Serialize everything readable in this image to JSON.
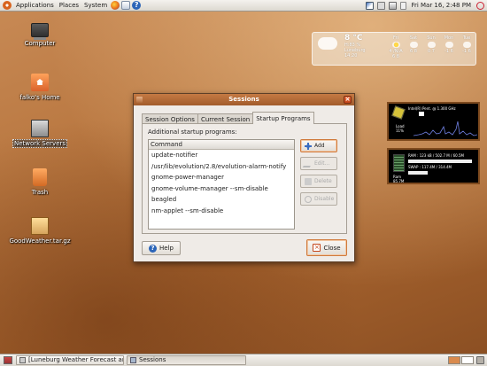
{
  "top_panel": {
    "menus": [
      "Applications",
      "Places",
      "System"
    ],
    "clock": "Fri Mar 16,  2:48 PM"
  },
  "desktop_icons": [
    {
      "label": "Computer",
      "icon": "computer-icon"
    },
    {
      "label": "falko's Home",
      "icon": "home-folder-icon"
    },
    {
      "label": "Network Servers",
      "icon": "network-icon"
    },
    {
      "label": "Trash",
      "icon": "trash-icon"
    },
    {
      "label": "GoodWeather.tar.gz",
      "icon": "archive-icon"
    }
  ],
  "weather": {
    "temp": "8 °C",
    "line1": "H:83 %",
    "location": "Luneburg",
    "time": "14:20",
    "days": [
      {
        "name": "Fri",
        "temps": "4 /N/A 6 8"
      },
      {
        "name": "Sat",
        "temps": "6 8"
      },
      {
        "name": "Sun",
        "temps": "0 7"
      },
      {
        "name": "Mon",
        "temps": "-1 6"
      },
      {
        "name": "Tue",
        "temps": "-1 6"
      }
    ]
  },
  "conky": {
    "cpu_label": "Intel(R) Pent. @ 1.300 GHz",
    "load_label": "Load",
    "load_value": "11%",
    "ram_label": "RAM : 123 kB / 502.7 M / 60.5M",
    "swap_label": "SWAP : 117.4M / 314.4M",
    "ram_title": "Ram",
    "ram_value": "85.7M"
  },
  "dialog": {
    "title": "Sessions",
    "tabs": [
      "Session Options",
      "Current Session",
      "Startup Programs"
    ],
    "active_tab": 2,
    "section_label": "Additional startup programs:",
    "column_header": "Command",
    "commands": [
      "update-notifier",
      "/usr/lib/evolution/2.8/evolution-alarm-notify",
      "gnome-power-manager",
      "gnome-volume-manager --sm-disable",
      "beagled",
      "nm-applet --sm-disable"
    ],
    "buttons": {
      "add": "Add",
      "edit": "Edit...",
      "delete": "Delete",
      "disable": "Disable",
      "help": "Help",
      "close": "Close"
    }
  },
  "taskbar": {
    "tasks": [
      "[Luneburg Weather Forecast and ...",
      "Sessions"
    ]
  },
  "colors": {
    "accent": "#d07a3c",
    "titlebar": "#b36a36",
    "desktop": "#b8763f"
  }
}
